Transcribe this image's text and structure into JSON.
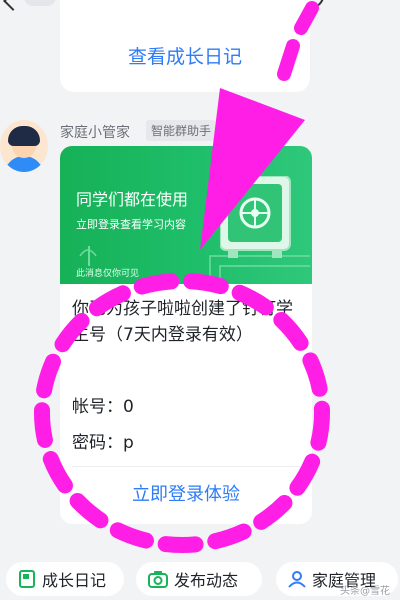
{
  "card1": {
    "link": "查看成长日记"
  },
  "sender": {
    "name": "家庭小管家",
    "tag": "智能群助手"
  },
  "message": {
    "banner_title": "同学们都在使用",
    "banner_subtitle": "立即登录查看学习内容",
    "banner_note": "此消息仅你可见",
    "body": "你已为孩子啦啦创建了钉钉学生号（7天内登录有效）",
    "account": "帐号：0",
    "password": "密码：p",
    "action": "立即登录体验"
  },
  "bottom_bar": {
    "items": [
      {
        "label": "成长日记",
        "icon": "journal-icon"
      },
      {
        "label": "发布动态",
        "icon": "camera-icon"
      },
      {
        "label": "家庭管理",
        "icon": "person-icon"
      }
    ]
  },
  "watermark": "头条@雪花",
  "colors": {
    "accent_blue": "#2f7cf6",
    "banner_green": "#1fbe6a",
    "annotation_magenta": "#ff1ee6"
  }
}
